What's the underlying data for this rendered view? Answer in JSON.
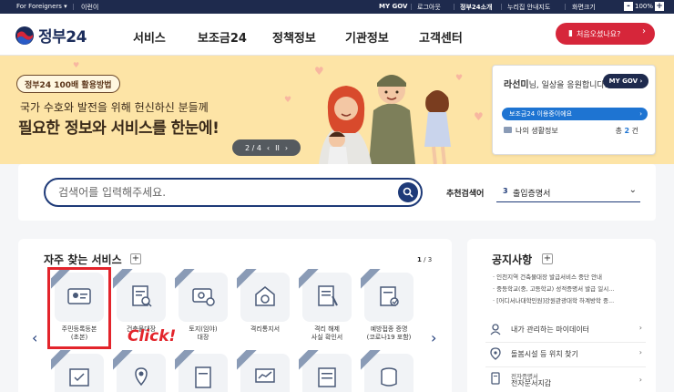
{
  "topbar": {
    "for_foreigners": "For Foreigners",
    "english": "이런이",
    "mygov": "MY GOV",
    "logout": "로그아웃",
    "about": "정부24소개",
    "sitemap": "누리집 안내지도",
    "zoom_label": "화면크기",
    "zoom_minus": "-",
    "zoom_value": "100%",
    "zoom_plus": "+"
  },
  "header": {
    "logo_text": "정부24",
    "nav": [
      "서비스",
      "보조금24",
      "정책정보",
      "기관정보",
      "고객센터"
    ],
    "cta_label": "처음오셨나요?",
    "cta_arrow": "›"
  },
  "banner": {
    "pill": "정부24 100배 활용방법",
    "subtitle": "국가 수호와 발전을 위해 헌신하신 분들께",
    "headline": "필요한 정보와 서비스를 한눈에!",
    "pager_text": "2 / 4",
    "pager_prev": "‹",
    "pager_pause": "II",
    "pager_next": "›"
  },
  "user_panel": {
    "name": "라선미",
    "greeting_suffix": "님, 일상을 응원합니다.",
    "mygov_button": "MY GOV",
    "subsidy_bar": "보조금24 이용중이에요",
    "life_info": "나의 생활정보",
    "count_prefix": "총",
    "count": "2",
    "count_suffix": "건"
  },
  "search": {
    "placeholder": "검색어를 입력해주세요.",
    "recommend_label": "추천검색어",
    "recommend_num": "3",
    "recommend_text": "출입증명서"
  },
  "services": {
    "title": "자주 찾는 서비스",
    "plus": "+",
    "page_current": "1",
    "page_total": "/ 3",
    "prev": "‹",
    "next": "›",
    "click_annotation": "Click!",
    "tiles": [
      {
        "label": "주민등록등본\n(초본)",
        "icon": "id-card-icon"
      },
      {
        "label": "건축물대장",
        "icon": "document-search-icon"
      },
      {
        "label": "토지(임야)\n대장",
        "icon": "land-survey-icon"
      },
      {
        "label": "격리통지서",
        "icon": "quarantine-notice-icon"
      },
      {
        "label": "격리 해제\n사실 확인서",
        "icon": "release-certificate-icon"
      },
      {
        "label": "예방접종 증명\n(코로나19 포함)",
        "icon": "vaccination-icon"
      },
      {
        "label": "",
        "icon": "map-check-icon"
      },
      {
        "label": "",
        "icon": "location-map-icon"
      },
      {
        "label": "",
        "icon": "paper-icon"
      },
      {
        "label": "",
        "icon": "presentation-chart-icon"
      },
      {
        "label": "",
        "icon": "table-list-icon"
      },
      {
        "label": "",
        "icon": "database-icon"
      }
    ]
  },
  "notices": {
    "title": "공지사항",
    "plus": "+",
    "items": [
      "· 인천지역 건축물대장 발급서비스 중단 안내",
      "· 중등학교(중, 고등학교) 성적증명서 발급 일시...",
      "· [어디서나대학민원]강원관광대학 하계방학 중..."
    ],
    "links": [
      {
        "label": "내가 관리하는 마이데이터",
        "icon": "user-data-icon",
        "arrow": "›"
      },
      {
        "label": "돌봄시설 등 위치 찾기",
        "icon": "location-pin-icon",
        "arrow": "›"
      },
      {
        "label_top": "전자증명서",
        "label": "전자문서지갑",
        "icon": "e-wallet-icon",
        "arrow": "›"
      }
    ]
  },
  "colors": {
    "navy": "#1e2a4d",
    "cta_red": "#d6263a",
    "banner_bg": "#fde4a6",
    "accent_blue": "#1e74d2",
    "highlight_red": "#e3242b"
  }
}
